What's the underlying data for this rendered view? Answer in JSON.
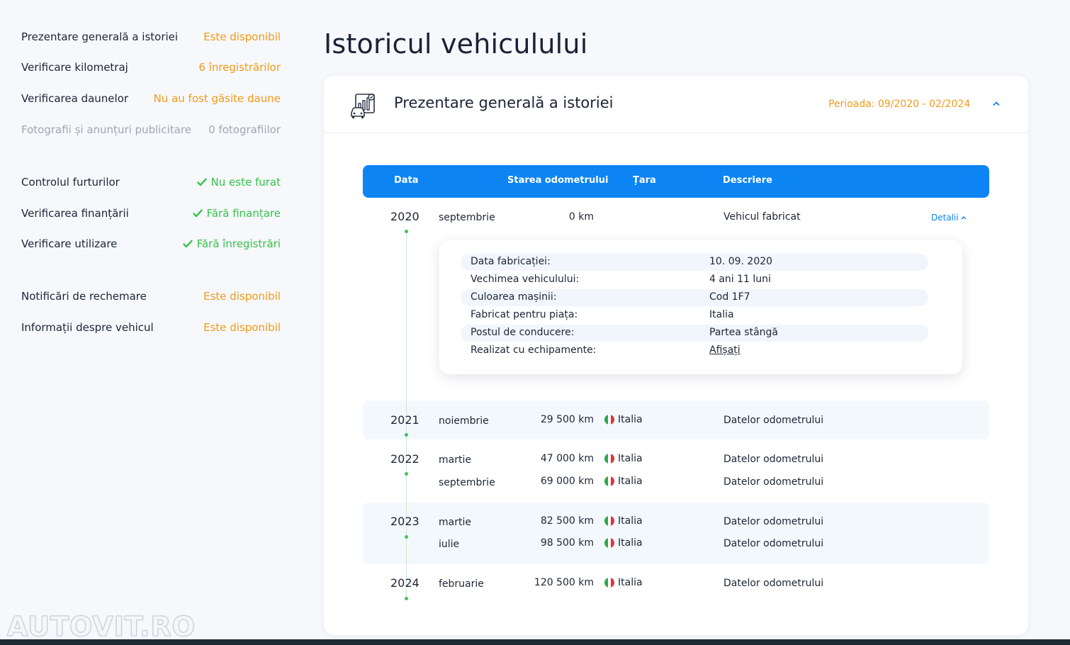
{
  "sidebar": {
    "items": [
      {
        "label": "Prezentare generală a istoriei",
        "value": "Este disponibil"
      },
      {
        "label": "Verificare kilometraj",
        "value": "6 înregistrărilor"
      },
      {
        "label": "Verificarea daunelor",
        "value": "Nu au fost găsite daune"
      },
      {
        "label": "Fotografii și anunțuri publicitare",
        "value": "0 fotografiilor"
      },
      {
        "label": "Controlul furturilor",
        "value": "Nu este furat"
      },
      {
        "label": "Verificarea finanțării",
        "value": "Fără finanțare"
      },
      {
        "label": "Verificare utilizare",
        "value": "Fără înregistrări"
      },
      {
        "label": "Notificări de rechemare",
        "value": "Este disponibil"
      },
      {
        "label": "Informații despre vehicul",
        "value": "Este disponibil"
      }
    ]
  },
  "page_title": "Istoricul vehiculului",
  "card": {
    "title": "Prezentare generală a istoriei",
    "period": "Perioada: 09/2020 - 02/2024"
  },
  "table": {
    "headers": {
      "date": "Data",
      "odometer": "Starea odometrului",
      "country": "Țara",
      "description": "Descriere"
    },
    "details_link": "Detalii",
    "rows": [
      {
        "year": "2020",
        "month": "septembrie",
        "km": "0 km",
        "country": "",
        "desc": "Vehicul fabricat"
      },
      {
        "year": "2021",
        "month": "noiembrie",
        "km": "29 500 km",
        "country": "Italia",
        "desc": "Datelor odometrului"
      },
      {
        "year": "2022",
        "month": "martie",
        "km": "47 000 km",
        "country": "Italia",
        "desc": "Datelor odometrului"
      },
      {
        "year": "",
        "month": "septembrie",
        "km": "69 000 km",
        "country": "Italia",
        "desc": "Datelor odometrului"
      },
      {
        "year": "2023",
        "month": "martie",
        "km": "82 500 km",
        "country": "Italia",
        "desc": "Datelor odometrului"
      },
      {
        "year": "",
        "month": "iulie",
        "km": "98 500 km",
        "country": "Italia",
        "desc": "Datelor odometrului"
      },
      {
        "year": "2024",
        "month": "februarie",
        "km": "120 500 km",
        "country": "Italia",
        "desc": "Datelor odometrului"
      }
    ]
  },
  "details": [
    {
      "key": "Data fabricației:",
      "value": "10. 09. 2020"
    },
    {
      "key": "Vechimea vehiculului:",
      "value": "4 ani 11 luni"
    },
    {
      "key": "Culoarea mașinii:",
      "value": "Cod 1F7"
    },
    {
      "key": "Fabricat pentru piața:",
      "value": "Italia"
    },
    {
      "key": "Postul de conducere:",
      "value": "Partea stângă"
    },
    {
      "key": "Realizat cu echipamente:",
      "value": "Afișați"
    }
  ],
  "watermark": "AUTOVIT.RO",
  "colors": {
    "accent": "#0c84f4",
    "orange": "#f39a18",
    "green": "#36c24a"
  }
}
